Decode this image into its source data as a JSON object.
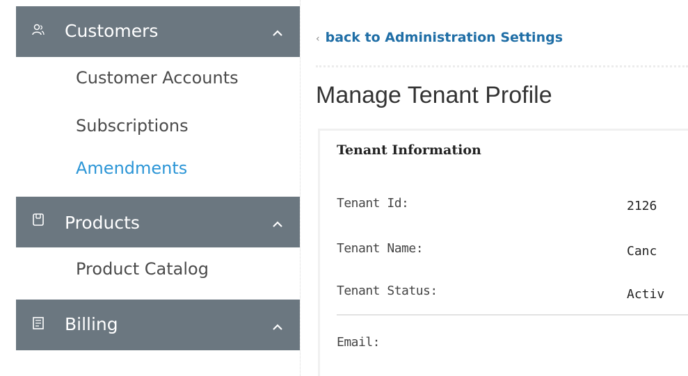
{
  "sidebar": {
    "sections": [
      {
        "label": "Customers",
        "icon": "people-icon",
        "items": [
          {
            "label": "Customer Accounts",
            "active": false
          },
          {
            "label": "Subscriptions",
            "active": false
          },
          {
            "label": "Amendments",
            "active": true
          }
        ]
      },
      {
        "label": "Products",
        "icon": "product-icon",
        "items": [
          {
            "label": "Product Catalog",
            "active": false
          }
        ]
      },
      {
        "label": "Billing",
        "icon": "billing-icon",
        "items": []
      }
    ]
  },
  "main": {
    "back_link": "back to Administration Settings",
    "page_title": "Manage Tenant Profile",
    "panel": {
      "title": "Tenant Information",
      "fields": [
        {
          "label": "Tenant Id:",
          "value": "2126"
        },
        {
          "label": "Tenant Name:",
          "value": "Canc"
        },
        {
          "label": "Tenant Status:",
          "value": "Activ"
        },
        {
          "label": "Email:",
          "value": ""
        }
      ]
    }
  },
  "colors": {
    "sidebar_header_bg": "#6b7780",
    "active_link": "#2b95d6",
    "back_link": "#1f6ea6"
  }
}
